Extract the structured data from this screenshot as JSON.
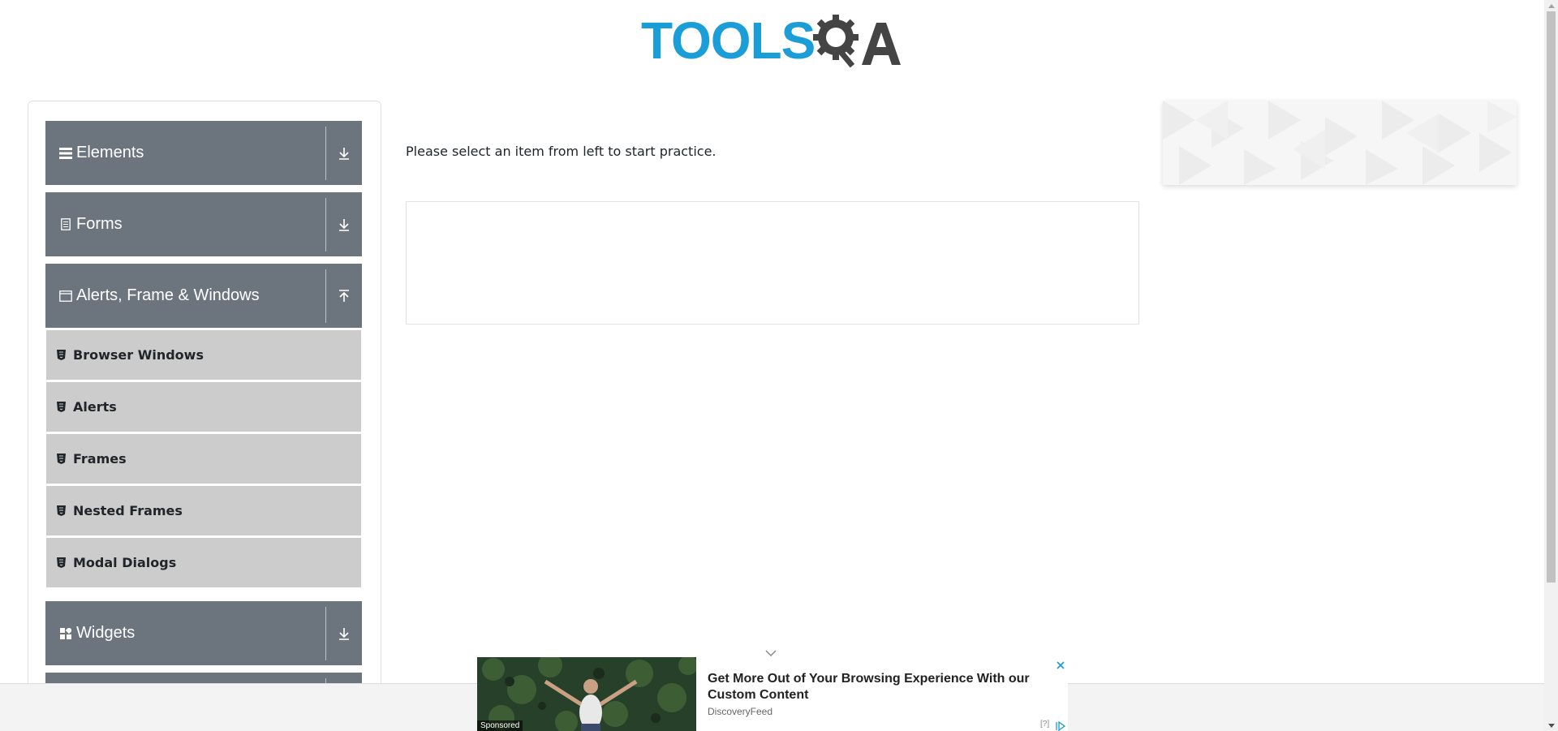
{
  "header": {
    "logo_text_primary": "TOOLS",
    "logo_text_secondary": "QA"
  },
  "sidebar": {
    "groups": [
      {
        "label": "Elements",
        "icon": "hamburger-icon",
        "expanded": false
      },
      {
        "label": "Forms",
        "icon": "document-icon",
        "expanded": false
      },
      {
        "label": "Alerts, Frame & Windows",
        "icon": "window-icon",
        "expanded": true,
        "items": [
          "Browser Windows",
          "Alerts",
          "Frames",
          "Nested Frames",
          "Modal Dialogs"
        ]
      },
      {
        "label": "Widgets",
        "icon": "widgets-icon",
        "expanded": false
      }
    ],
    "item_icon": "html5-icon",
    "colors": {
      "group_bg": "#6c757d",
      "item_bg": "#cccccc"
    }
  },
  "main": {
    "instruction": "Please select an item from left to start practice."
  },
  "bottom_ad": {
    "title": "Get More Out of Your Browsing Experience With our Custom Content",
    "source": "DiscoveryFeed",
    "badge": "Sponsored",
    "help": "[?]"
  },
  "colors": {
    "brand_blue": "#1b9dd8",
    "brand_dark": "#444444"
  }
}
